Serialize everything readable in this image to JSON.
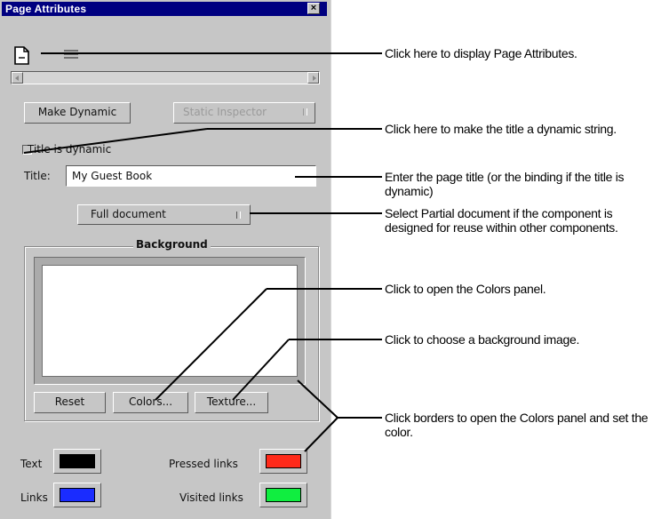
{
  "panel": {
    "title": "Page Attributes",
    "close_glyph": "×",
    "buttons": {
      "make_dynamic": "Make Dynamic",
      "static_inspector": "Static Inspector"
    },
    "title_dynamic_checkbox": {
      "label": "Title is dynamic",
      "checked": false
    },
    "title_field": {
      "label": "Title:",
      "value": "My Guest Book"
    },
    "document_type_select": {
      "selected": "Full document"
    },
    "background": {
      "heading": "Background",
      "buttons": {
        "reset": "Reset",
        "colors": "Colors...",
        "texture": "Texture..."
      }
    },
    "colors": {
      "text": {
        "label": "Text",
        "color": "#000000"
      },
      "links": {
        "label": "Links",
        "color": "#1a2cff"
      },
      "pressed_links": {
        "label": "Pressed links",
        "color": "#ff2a1a"
      },
      "visited_links": {
        "label": "Visited links",
        "color": "#10ee40"
      }
    }
  },
  "annotations": {
    "page_attributes": "Click here to display Page Attributes.",
    "dynamic_title": "Click here to make the title a dynamic string.",
    "page_title": "Enter the page title (or the binding if the title is dynamic)",
    "partial_document": "Select Partial document if the component is designed for reuse within other components.",
    "colors_panel": "Click to open the Colors panel.",
    "background_image": "Click to choose a background image.",
    "borders": "Click borders to open the Colors panel and set the color."
  }
}
